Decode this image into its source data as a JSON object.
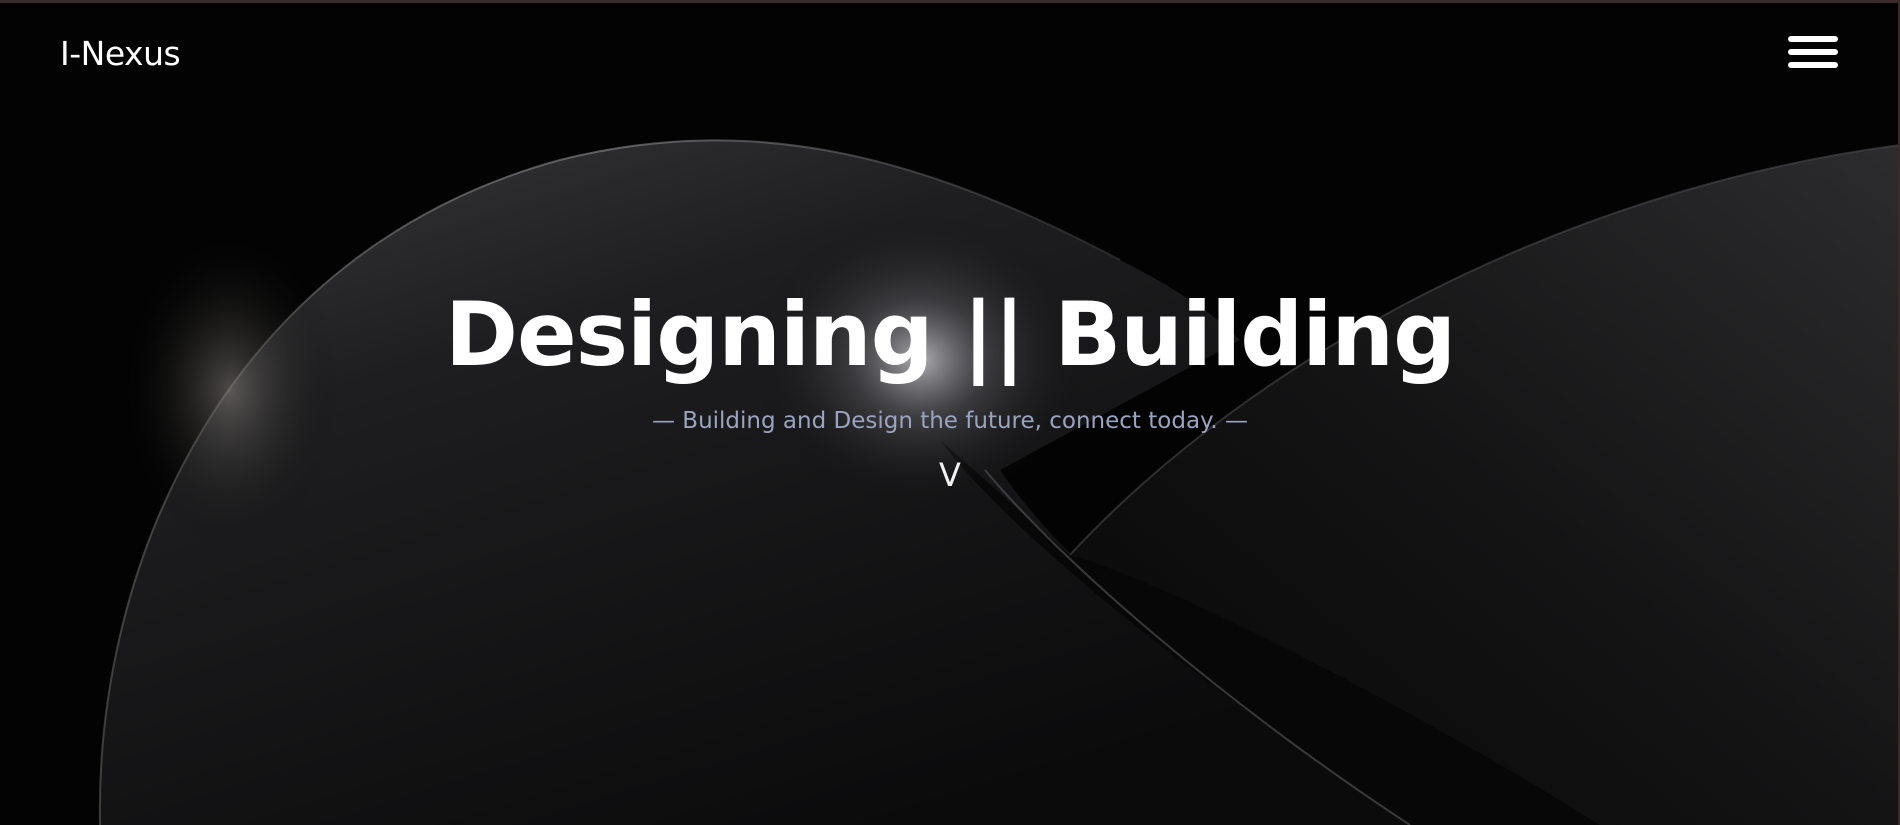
{
  "navbar": {
    "brand": "I-Nexus",
    "menu_icon": "hamburger-menu-icon"
  },
  "hero": {
    "title": "Designing || Building",
    "subtitle": "— Building and Design the future, connect today. —",
    "scroll_indicator": "V"
  },
  "colors": {
    "background": "#030303",
    "text": "#ffffff",
    "subtitle": "#9aa4c0"
  }
}
